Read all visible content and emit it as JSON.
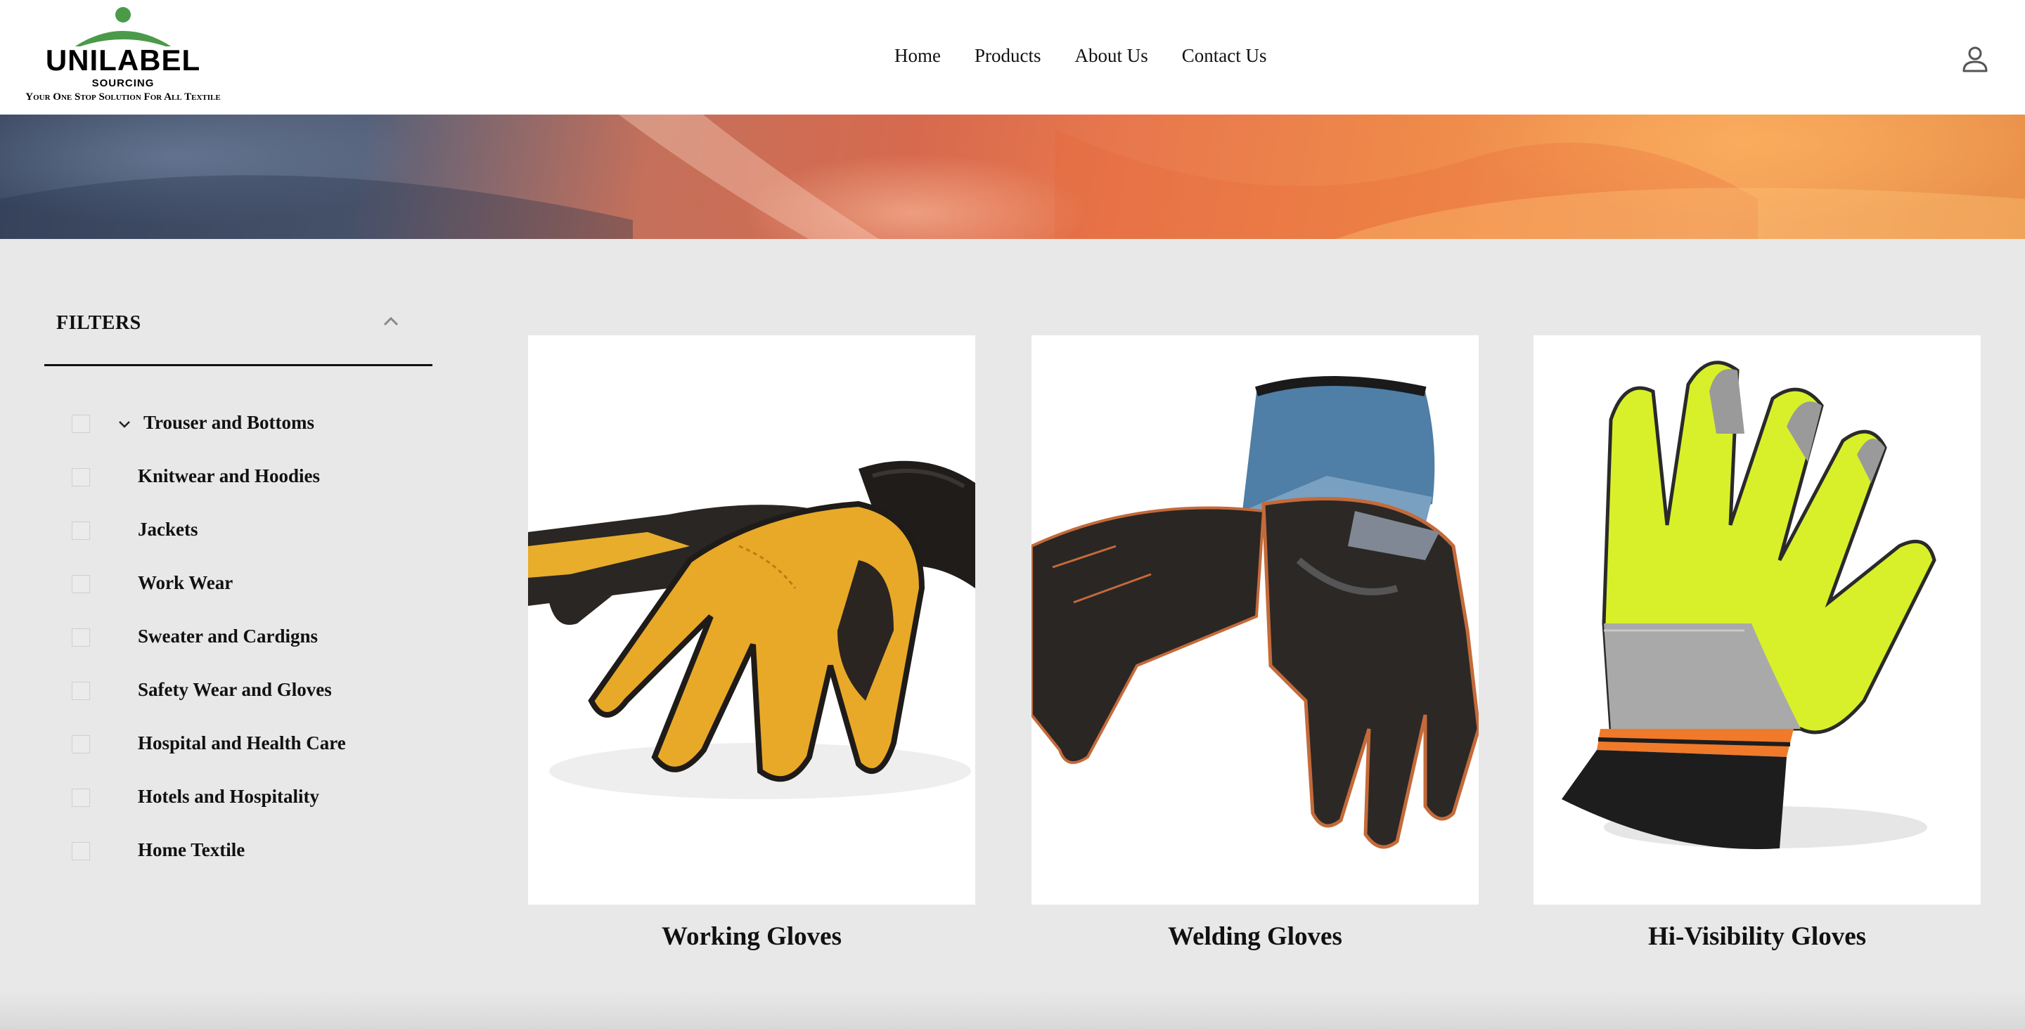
{
  "brand": {
    "name": "UNILABEL",
    "sub": "SOURCING",
    "tagline": "Your One Stop Solution For All Textile",
    "accent_color": "#4a9a4a"
  },
  "nav": {
    "items": [
      {
        "label": "Home"
      },
      {
        "label": "Products"
      },
      {
        "label": "About Us"
      },
      {
        "label": "Contact Us"
      }
    ],
    "account_icon": "user-icon"
  },
  "filters": {
    "title": "FILTERS",
    "toggle_icon": "chevron-up-icon",
    "items": [
      {
        "label": "Trouser and Bottoms",
        "expand_icon": "chevron-down-icon",
        "checked": false
      },
      {
        "label": "Knitwear and Hoodies",
        "checked": false
      },
      {
        "label": "Jackets",
        "checked": false
      },
      {
        "label": "Work Wear",
        "checked": false
      },
      {
        "label": "Sweater and Cardigns",
        "checked": false
      },
      {
        "label": "Safety Wear and Gloves",
        "checked": false
      },
      {
        "label": "Hospital and Health Care",
        "checked": false
      },
      {
        "label": "Hotels and Hospitality",
        "checked": false
      },
      {
        "label": "Home Textile",
        "checked": false
      }
    ]
  },
  "products": [
    {
      "name": "Working Gloves",
      "image": "yellow-black-leather-gloves"
    },
    {
      "name": "Welding Gloves",
      "image": "black-leather-blue-cuff-gloves"
    },
    {
      "name": "Hi-Visibility Gloves",
      "image": "neon-yellow-reflective-glove"
    }
  ]
}
